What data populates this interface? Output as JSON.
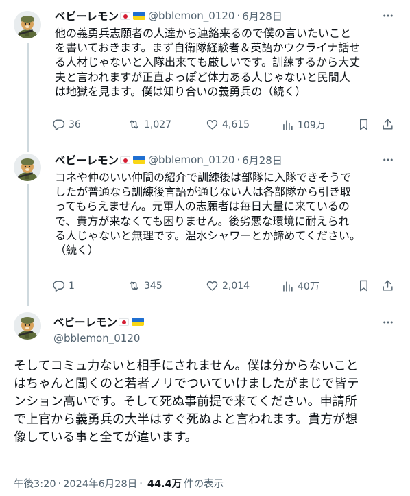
{
  "tweets": [
    {
      "name": "ベビーレモン",
      "handle": "@bblemon_0120",
      "separator": "·",
      "date": "6月28日",
      "lines": [
        "他の義勇兵志願者の人達から連絡来るので僕の言いたいこと",
        "を書いておきます。まず自衛隊経験者＆英語かウクライナ話せ",
        "る人材じゃないと入隊出来ても厳しいです。訓練するから大丈",
        "夫と言われますが正直よっぽど体力ある人じゃないと民間人",
        "は地獄を見ます。僕は知り合いの義勇兵の（続く）"
      ],
      "stats": {
        "replies": "36",
        "reposts": "1,027",
        "likes": "4,615",
        "views": "109万"
      }
    },
    {
      "name": "ベビーレモン",
      "handle": "@bblemon_0120",
      "separator": "·",
      "date": "6月28日",
      "lines": [
        "コネや仲のいい仲間の紹介で訓練後は部隊に入隊できそうで",
        "したが普通なら訓練後言語が通じない人は各部隊から引き取",
        "ってもらえません。元軍人の志願者は毎日大量に来ているの",
        "で、貴方が来なくても困りません。後劣悪な環境に耐えられ",
        "る人じゃないと無理です。温水シャワーとか諦めてください。",
        "（続く）"
      ],
      "stats": {
        "replies": "1",
        "reposts": "345",
        "likes": "2,014",
        "views": "40万"
      }
    }
  ],
  "main": {
    "name": "ベビーレモン",
    "handle": "@bblemon_0120",
    "lines": [
      "そしてコミュ力ないと相手にされません。僕は分からないこと",
      "はちゃんと聞くのと若者ノリでついていけましたがまじで皆テ",
      "ンション高いです。そして死ぬ事前提で来てください。申請所",
      "で上官から義勇兵の大半はすぐ死ぬよと言われます。貴方が想",
      "像している事と全てが違います。"
    ],
    "time": "午後3:20",
    "separator": "·",
    "date": "2024年6月28日",
    "views": "44.4万",
    "views_label": "件の表示"
  },
  "icons": {
    "reply": "reply-icon",
    "repost": "repost-icon",
    "like": "heart-icon",
    "views": "views-chart-icon",
    "bookmark": "bookmark-icon",
    "share": "share-icon",
    "more": "more-icon",
    "flag_jp": "japan-flag-icon",
    "flag_ua": "ukraine-flag-icon"
  },
  "colors": {
    "text": "#0f1419",
    "muted": "#536471",
    "thread_line": "#cfd9de"
  }
}
